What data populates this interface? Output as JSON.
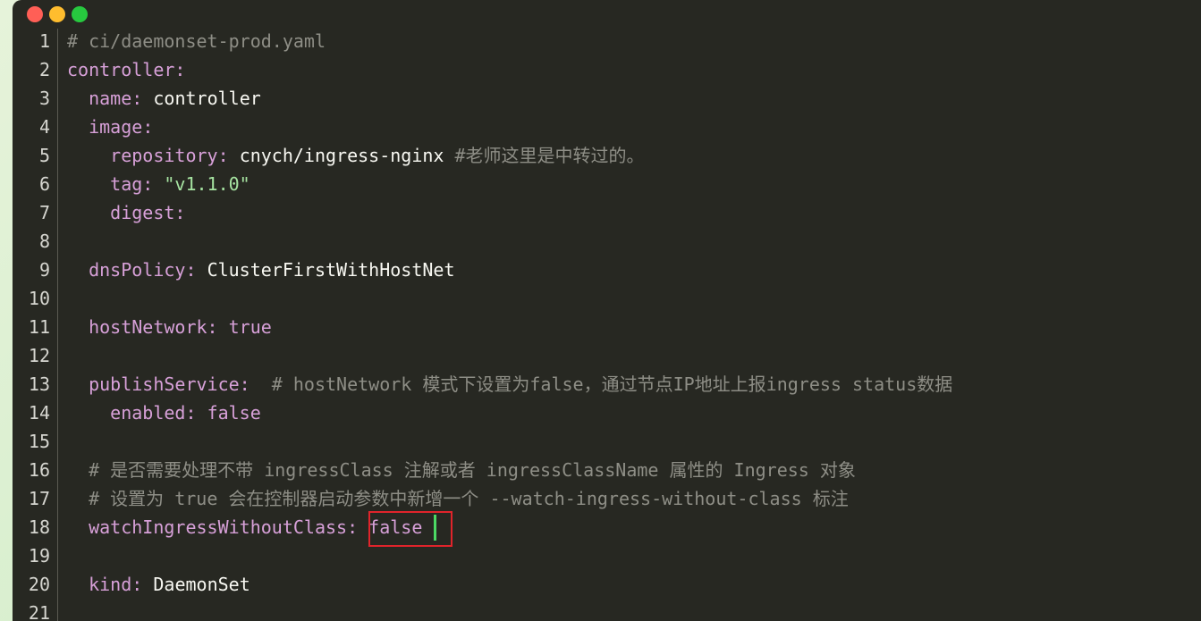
{
  "window": {
    "buttons": [
      "close",
      "minimize",
      "maximize"
    ]
  },
  "editor": {
    "lines": [
      {
        "num": "1",
        "indent": "",
        "key": "",
        "sep": "",
        "value": "",
        "value_type": "",
        "comment": "# ci/daemonset-prod.yaml"
      },
      {
        "num": "2",
        "indent": "",
        "key": "controller",
        "sep": ":",
        "value": "",
        "value_type": "",
        "comment": ""
      },
      {
        "num": "3",
        "indent": "  ",
        "key": "name",
        "sep": ": ",
        "value": "controller",
        "value_type": "v",
        "comment": ""
      },
      {
        "num": "4",
        "indent": "  ",
        "key": "image",
        "sep": ":",
        "value": "",
        "value_type": "",
        "comment": ""
      },
      {
        "num": "5",
        "indent": "    ",
        "key": "repository",
        "sep": ": ",
        "value": "cnych/ingress-nginx",
        "value_type": "v",
        "comment": " #老师这里是中转过的。"
      },
      {
        "num": "6",
        "indent": "    ",
        "key": "tag",
        "sep": ": ",
        "value": "\"v1.1.0\"",
        "value_type": "s",
        "comment": ""
      },
      {
        "num": "7",
        "indent": "    ",
        "key": "digest",
        "sep": ":",
        "value": "",
        "value_type": "",
        "comment": ""
      },
      {
        "num": "8",
        "indent": "",
        "key": "",
        "sep": "",
        "value": "",
        "value_type": "",
        "comment": ""
      },
      {
        "num": "9",
        "indent": "  ",
        "key": "dnsPolicy",
        "sep": ": ",
        "value": "ClusterFirstWithHostNet",
        "value_type": "v",
        "comment": ""
      },
      {
        "num": "10",
        "indent": "",
        "key": "",
        "sep": "",
        "value": "",
        "value_type": "",
        "comment": ""
      },
      {
        "num": "11",
        "indent": "  ",
        "key": "hostNetwork",
        "sep": ": ",
        "value": "true",
        "value_type": "b",
        "comment": ""
      },
      {
        "num": "12",
        "indent": "",
        "key": "",
        "sep": "",
        "value": "",
        "value_type": "",
        "comment": ""
      },
      {
        "num": "13",
        "indent": "  ",
        "key": "publishService",
        "sep": ":",
        "value": "",
        "value_type": "",
        "comment": "  # hostNetwork 模式下设置为false，通过节点IP地址上报ingress status数据"
      },
      {
        "num": "14",
        "indent": "    ",
        "key": "enabled",
        "sep": ": ",
        "value": "false",
        "value_type": "b",
        "comment": ""
      },
      {
        "num": "15",
        "indent": "",
        "key": "",
        "sep": "",
        "value": "",
        "value_type": "",
        "comment": ""
      },
      {
        "num": "16",
        "indent": "  ",
        "key": "",
        "sep": "",
        "value": "",
        "value_type": "",
        "comment": "# 是否需要处理不带 ingressClass 注解或者 ingressClassName 属性的 Ingress 对象"
      },
      {
        "num": "17",
        "indent": "  ",
        "key": "",
        "sep": "",
        "value": "",
        "value_type": "",
        "comment": "# 设置为 true 会在控制器启动参数中新增一个 --watch-ingress-without-class 标注"
      },
      {
        "num": "18",
        "indent": "  ",
        "key": "watchIngressWithoutClass",
        "sep": ": ",
        "value": "false",
        "value_type": "b",
        "comment": ""
      },
      {
        "num": "19",
        "indent": "",
        "key": "",
        "sep": "",
        "value": "",
        "value_type": "",
        "comment": ""
      },
      {
        "num": "20",
        "indent": "  ",
        "key": "kind",
        "sep": ": ",
        "value": "DaemonSet",
        "value_type": "v",
        "comment": ""
      },
      {
        "num": "21",
        "indent": "",
        "key": "",
        "sep": "",
        "value": "",
        "value_type": "",
        "comment": ""
      }
    ]
  },
  "colors": {
    "background": "#272822",
    "key": "#d7a0d8",
    "string": "#a6e3a1",
    "comment": "#8e8e86",
    "highlight_box": "#e0242b",
    "cursor": "#4cd964"
  }
}
